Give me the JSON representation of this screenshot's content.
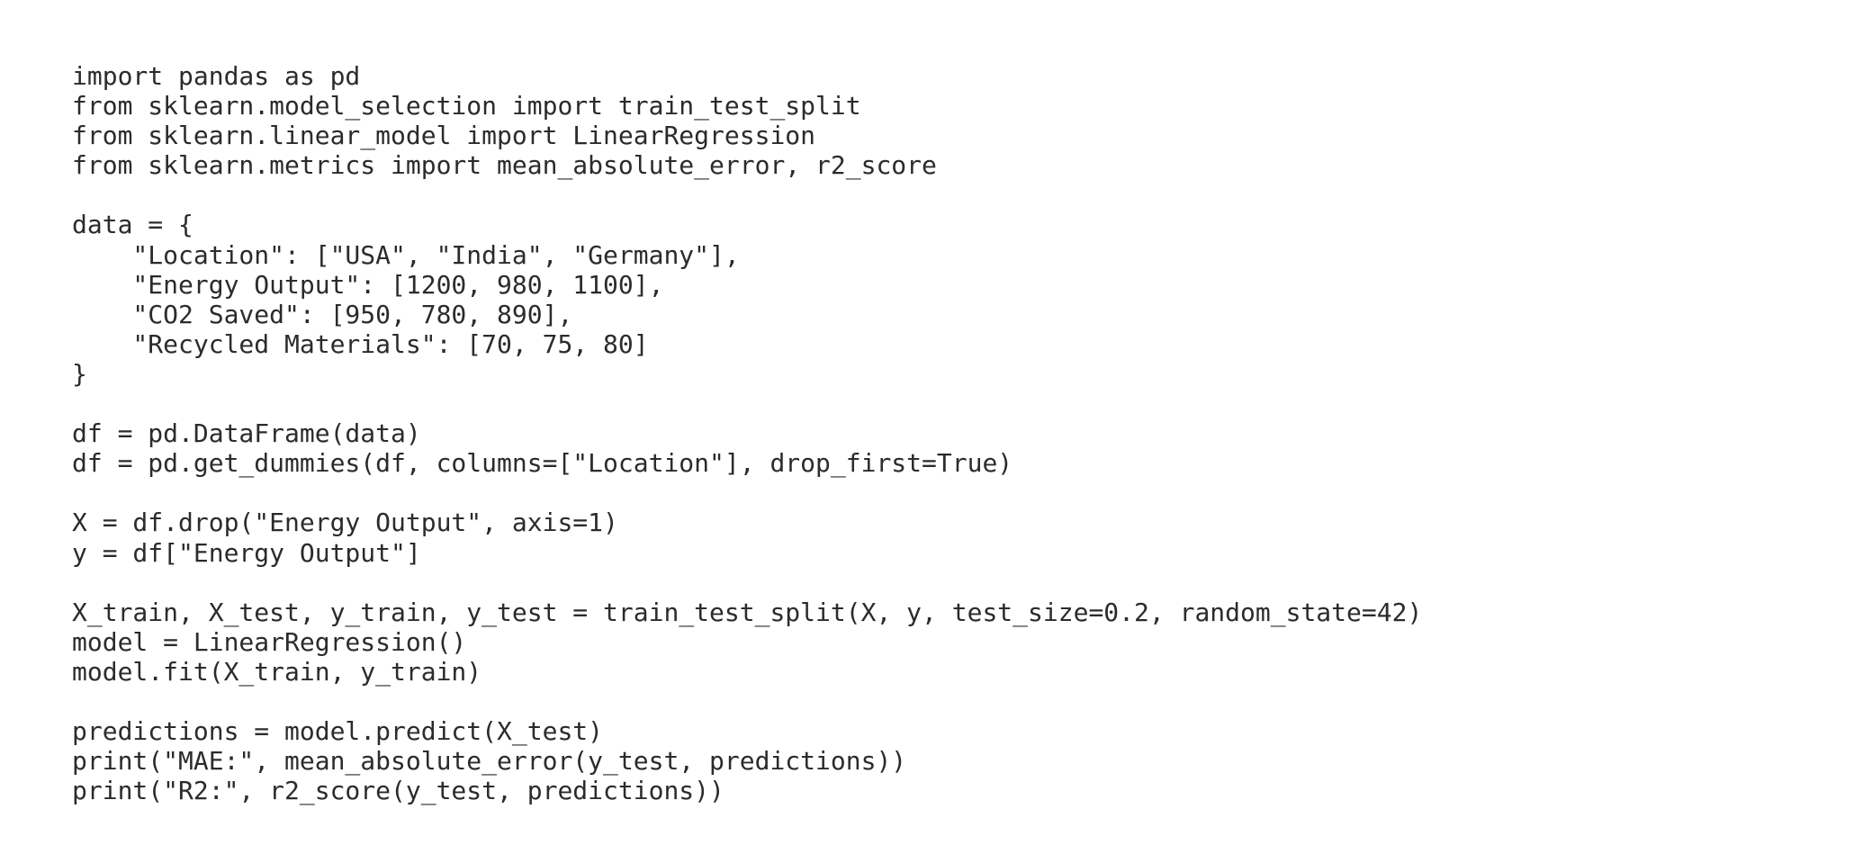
{
  "code": {
    "lines": [
      "import pandas as pd",
      "from sklearn.model_selection import train_test_split",
      "from sklearn.linear_model import LinearRegression",
      "from sklearn.metrics import mean_absolute_error, r2_score",
      "",
      "data = {",
      "    \"Location\": [\"USA\", \"India\", \"Germany\"],",
      "    \"Energy Output\": [1200, 980, 1100],",
      "    \"CO2 Saved\": [950, 780, 890],",
      "    \"Recycled Materials\": [70, 75, 80]",
      "}",
      "",
      "df = pd.DataFrame(data)",
      "df = pd.get_dummies(df, columns=[\"Location\"], drop_first=True)",
      "",
      "X = df.drop(\"Energy Output\", axis=1)",
      "y = df[\"Energy Output\"]",
      "",
      "X_train, X_test, y_train, y_test = train_test_split(X, y, test_size=0.2, random_state=42)",
      "model = LinearRegression()",
      "model.fit(X_train, y_train)",
      "",
      "predictions = model.predict(X_test)",
      "print(\"MAE:\", mean_absolute_error(y_test, predictions))",
      "print(\"R2:\", r2_score(y_test, predictions))"
    ]
  }
}
